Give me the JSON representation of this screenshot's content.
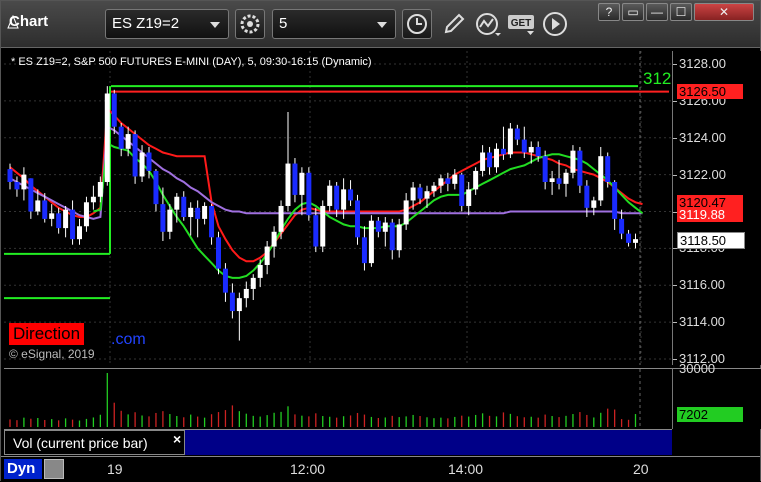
{
  "window": {
    "title": "Chart",
    "symbol": "ES Z19=2",
    "interval": "5",
    "controls": {
      "help": "?",
      "restore": "▭",
      "minimize": "—",
      "maximize": "☐",
      "close": "✕"
    }
  },
  "toolbar": {
    "icons": [
      "settings-icon",
      "clock-icon",
      "pencil-icon",
      "study-icon",
      "get-icon",
      "play-icon"
    ],
    "get_label": "GET"
  },
  "chart": {
    "info_line": "* ES Z19=2, S&P 500 FUTURES E-MINI (DAY), 5, 09:30-16:15 (Dynamic)",
    "direction_label": "Direction",
    "direction_tail": ".com",
    "copyright": "© eSignal, 2019",
    "line_label": "312",
    "price_labels": {
      "red_line": "3126.50",
      "ma_red": "3120.47",
      "ma_purple": "3119.88",
      "last_price": "3118.50"
    },
    "volume_label": "7202",
    "volume_axis_top": "30000",
    "legend_text": "Vol (current price bar)",
    "legend_close": "×",
    "dyn_label": "Dyn",
    "time_labels": [
      "19",
      "12:00",
      "14:00",
      "20"
    ]
  },
  "colors": {
    "up": "#ffffff",
    "down": "#1a2bff",
    "ma_red": "#ff1a1a",
    "ma_green": "#22dd22",
    "ma_purple": "#a070e0",
    "level_green": "#22ee22",
    "level_red": "#ff2020",
    "vol_up": "#22cc22",
    "vol_down": "#cc2222"
  },
  "chart_data": {
    "type": "candlestick",
    "y_axis_ticks": [
      "3128.00",
      "3126.00",
      "3124.00",
      "3122.00",
      "3120.00",
      "3118.00",
      "3116.00",
      "3114.00",
      "3112.00"
    ],
    "ylim": [
      3111.5,
      3128.5
    ],
    "x_ticks": [
      "19",
      "12:00",
      "14:00",
      "20"
    ],
    "levels": {
      "green_upper": 3126.8,
      "red_upper": 3126.5,
      "green_lower_left": 3115.3,
      "green_mid_left": 3117.7
    },
    "candles": [
      [
        3122.3,
        3122.6,
        3121.2,
        3121.6
      ],
      [
        3121.6,
        3121.9,
        3120.8,
        3121.2
      ],
      [
        3121.2,
        3122.4,
        3120.6,
        3122.0
      ],
      [
        3121.8,
        3121.8,
        3119.6,
        3120.0
      ],
      [
        3120.0,
        3121.2,
        3119.8,
        3120.6
      ],
      [
        3120.6,
        3121.0,
        3119.4,
        3119.6
      ],
      [
        3119.6,
        3120.4,
        3119.2,
        3119.9
      ],
      [
        3119.9,
        3120.2,
        3118.8,
        3119.1
      ],
      [
        3119.1,
        3120.3,
        3118.6,
        3120.1
      ],
      [
        3120.1,
        3120.6,
        3118.2,
        3118.5
      ],
      [
        3118.5,
        3119.6,
        3118.2,
        3119.2
      ],
      [
        3119.2,
        3120.8,
        3118.9,
        3120.5
      ],
      [
        3120.5,
        3121.4,
        3120.1,
        3120.8
      ],
      [
        3120.8,
        3121.9,
        3120.5,
        3121.6
      ],
      [
        3121.6,
        3126.8,
        3121.4,
        3126.4
      ],
      [
        3126.4,
        3126.6,
        3124.2,
        3124.6
      ],
      [
        3124.6,
        3124.8,
        3123.0,
        3123.4
      ],
      [
        3123.4,
        3124.6,
        3123.0,
        3124.2
      ],
      [
        3124.2,
        3124.4,
        3121.5,
        3121.9
      ],
      [
        3121.9,
        3123.6,
        3121.6,
        3123.2
      ],
      [
        3123.2,
        3123.5,
        3121.8,
        3122.2
      ],
      [
        3122.2,
        3122.3,
        3120.0,
        3120.4
      ],
      [
        3120.4,
        3121.3,
        3118.4,
        3118.9
      ],
      [
        3118.9,
        3120.4,
        3118.5,
        3120.1
      ],
      [
        3120.1,
        3121.0,
        3119.4,
        3120.8
      ],
      [
        3120.8,
        3121.1,
        3119.5,
        3119.7
      ],
      [
        3119.7,
        3120.5,
        3118.7,
        3120.2
      ],
      [
        3120.2,
        3120.6,
        3118.6,
        3119.6
      ],
      [
        3119.6,
        3120.5,
        3119.3,
        3120.3
      ],
      [
        3120.3,
        3120.4,
        3118.2,
        3118.6
      ],
      [
        3118.6,
        3118.9,
        3116.6,
        3116.9
      ],
      [
        3116.9,
        3117.2,
        3115.1,
        3115.6
      ],
      [
        3115.6,
        3116.1,
        3114.2,
        3114.6
      ],
      [
        3114.6,
        3115.6,
        3113.0,
        3115.3
      ],
      [
        3115.3,
        3116.2,
        3114.8,
        3115.8
      ],
      [
        3115.8,
        3116.6,
        3115.2,
        3116.4
      ],
      [
        3116.4,
        3117.4,
        3115.9,
        3117.1
      ],
      [
        3117.1,
        3118.4,
        3116.6,
        3118.1
      ],
      [
        3118.1,
        3119.2,
        3117.5,
        3118.9
      ],
      [
        3118.9,
        3120.6,
        3118.5,
        3120.3
      ],
      [
        3120.3,
        3125.4,
        3120.0,
        3122.6
      ],
      [
        3122.6,
        3122.9,
        3120.5,
        3120.9
      ],
      [
        3120.9,
        3122.4,
        3119.8,
        3122.1
      ],
      [
        3122.1,
        3122.4,
        3119.5,
        3119.8
      ],
      [
        3119.8,
        3120.2,
        3117.8,
        3118.1
      ],
      [
        3118.1,
        3120.6,
        3117.8,
        3120.3
      ],
      [
        3120.3,
        3121.7,
        3120.0,
        3121.4
      ],
      [
        3121.4,
        3121.6,
        3119.7,
        3120.1
      ],
      [
        3120.1,
        3121.8,
        3119.6,
        3121.2
      ],
      [
        3121.2,
        3121.7,
        3120.3,
        3120.6
      ],
      [
        3120.6,
        3120.9,
        3118.2,
        3118.6
      ],
      [
        3118.6,
        3119.2,
        3116.8,
        3117.2
      ],
      [
        3117.2,
        3119.8,
        3117.0,
        3119.5
      ],
      [
        3119.5,
        3119.7,
        3118.6,
        3118.9
      ],
      [
        3118.9,
        3119.7,
        3118.1,
        3119.4
      ],
      [
        3119.4,
        3119.6,
        3117.4,
        3117.9
      ],
      [
        3117.9,
        3119.6,
        3117.5,
        3119.3
      ],
      [
        3119.3,
        3121.0,
        3119.0,
        3120.6
      ],
      [
        3120.6,
        3121.6,
        3120.1,
        3121.3
      ],
      [
        3121.3,
        3121.5,
        3120.4,
        3120.7
      ],
      [
        3120.7,
        3121.4,
        3120.2,
        3121.1
      ],
      [
        3121.1,
        3121.6,
        3120.8,
        3121.4
      ],
      [
        3121.4,
        3122.0,
        3121.0,
        3121.8
      ],
      [
        3121.8,
        3122.1,
        3121.1,
        3121.5
      ],
      [
        3121.5,
        3122.3,
        3121.2,
        3122.0
      ],
      [
        3122.0,
        3122.1,
        3120.0,
        3120.3
      ],
      [
        3120.3,
        3121.6,
        3119.8,
        3121.2
      ],
      [
        3121.2,
        3122.4,
        3120.9,
        3122.2
      ],
      [
        3122.2,
        3123.6,
        3121.9,
        3123.2
      ],
      [
        3123.2,
        3123.5,
        3122.0,
        3122.4
      ],
      [
        3122.4,
        3123.7,
        3122.1,
        3123.4
      ],
      [
        3123.4,
        3124.6,
        3122.8,
        3123.1
      ],
      [
        3123.1,
        3124.8,
        3122.9,
        3124.5
      ],
      [
        3124.5,
        3124.7,
        3123.6,
        3123.9
      ],
      [
        3123.9,
        3124.6,
        3122.9,
        3123.2
      ],
      [
        3123.2,
        3123.8,
        3122.6,
        3123.5
      ],
      [
        3123.5,
        3123.8,
        3122.7,
        3123.0
      ],
      [
        3123.0,
        3123.3,
        3121.2,
        3121.6
      ],
      [
        3121.6,
        3122.2,
        3120.9,
        3121.8
      ],
      [
        3121.8,
        3122.8,
        3121.2,
        3121.5
      ],
      [
        3121.5,
        3122.3,
        3120.8,
        3122.1
      ],
      [
        3122.1,
        3123.6,
        3121.8,
        3123.3
      ],
      [
        3123.3,
        3123.5,
        3121.0,
        3121.4
      ],
      [
        3121.4,
        3121.7,
        3119.7,
        3120.2
      ],
      [
        3120.2,
        3120.8,
        3119.8,
        3120.6
      ],
      [
        3120.6,
        3123.5,
        3120.3,
        3123.0
      ],
      [
        3123.0,
        3123.2,
        3121.3,
        3121.6
      ],
      [
        3121.6,
        3121.7,
        3119.0,
        3119.6
      ],
      [
        3119.6,
        3120.1,
        3118.5,
        3118.8
      ],
      [
        3118.8,
        3119.0,
        3118.1,
        3118.3
      ],
      [
        3118.3,
        3118.8,
        3118.0,
        3118.5
      ]
    ],
    "series": [
      {
        "name": "",
        "color": "ma_red",
        "values": [
          3122.4,
          3122.1,
          3121.8,
          3121.4,
          3121.1,
          3120.8,
          3120.5,
          3120.2,
          3120.0,
          3119.8,
          3119.7,
          3119.7,
          3119.9,
          3120.2,
          3125.6,
          3125.2,
          3124.8,
          3124.5,
          3124.2,
          3123.9,
          3123.6,
          3123.4,
          3123.2,
          3123.1,
          3123.0,
          3123.0,
          3123.0,
          3123.0,
          3123.0,
          3120.5,
          3119.2,
          3118.5,
          3117.9,
          3117.5,
          3117.3,
          3117.3,
          3117.5,
          3117.8,
          3118.3,
          3118.8,
          3119.3,
          3119.8,
          3120.1,
          3120.2,
          3120.1,
          3120.0,
          3120.0,
          3120.0,
          3120.0,
          3120.0,
          3120.0,
          3120.0,
          3120.0,
          3120.0,
          3120.0,
          3120.0,
          3120.0,
          3120.1,
          3120.3,
          3120.5,
          3120.8,
          3121.1,
          3121.4,
          3121.7,
          3122.0,
          3122.2,
          3122.4,
          3122.6,
          3122.8,
          3122.9,
          3123.0,
          3123.1,
          3123.2,
          3123.2,
          3123.2,
          3123.1,
          3123.0,
          3122.9,
          3122.8,
          3122.6,
          3122.5,
          3122.3,
          3122.2,
          3122.1,
          3122.0,
          3121.8,
          3121.6,
          3121.3,
          3121.0,
          3120.7,
          3120.5,
          3120.4
        ]
      },
      {
        "name": "",
        "color": "ma_purple",
        "values": [
          3121.8,
          3121.6,
          3121.4,
          3121.2,
          3121.0,
          3120.8,
          3120.6,
          3120.4,
          3120.2,
          3120.0,
          3119.8,
          3119.7,
          3119.6,
          3119.7,
          3124.6,
          3124.4,
          3124.1,
          3123.8,
          3123.5,
          3123.2,
          3122.9,
          3122.6,
          3122.3,
          3122.1,
          3121.8,
          3121.6,
          3121.3,
          3121.1,
          3120.8,
          3120.5,
          3120.3,
          3120.1,
          3120.0,
          3120.0,
          3119.9,
          3119.9,
          3119.9,
          3119.9,
          3119.9,
          3119.9,
          3119.9,
          3119.9,
          3119.9,
          3119.9,
          3119.9,
          3119.9,
          3119.9,
          3119.9,
          3119.9,
          3119.9,
          3119.9,
          3119.9,
          3119.9,
          3119.9,
          3119.9,
          3119.9,
          3119.9,
          3119.9,
          3119.9,
          3119.9,
          3119.9,
          3119.9,
          3119.9,
          3119.9,
          3119.9,
          3119.9,
          3119.9,
          3119.9,
          3119.9,
          3119.9,
          3119.9,
          3119.9,
          3120.0,
          3120.0,
          3120.0,
          3120.0,
          3120.0,
          3120.0,
          3120.0,
          3120.0,
          3120.0,
          3120.0,
          3120.0,
          3120.0,
          3120.0,
          3120.0,
          3120.0,
          3120.0,
          3119.9,
          3119.9,
          3119.9,
          3119.9
        ]
      },
      {
        "name": "",
        "color": "ma_green",
        "values": [
          null,
          null,
          null,
          null,
          null,
          null,
          null,
          null,
          null,
          null,
          null,
          null,
          3120.0,
          3120.1,
          3123.7,
          3123.5,
          3123.4,
          3123.3,
          3122.9,
          3122.6,
          3122.2,
          3121.6,
          3120.9,
          3120.3,
          3119.7,
          3119.2,
          3118.6,
          3118.0,
          3117.6,
          3117.2,
          3116.8,
          3116.5,
          3116.4,
          3116.4,
          3116.5,
          3116.8,
          3117.2,
          3117.7,
          3118.3,
          3119.0,
          3119.6,
          3120.1,
          3120.4,
          3120.5,
          3120.3,
          3120.0,
          3119.7,
          3119.5,
          3119.3,
          3119.2,
          3119.2,
          3119.1,
          3119.1,
          3119.1,
          3119.2,
          3119.2,
          3119.2,
          3119.4,
          3119.7,
          3120.0,
          3120.3,
          3120.6,
          3120.8,
          3120.9,
          3120.9,
          3120.9,
          3121.1,
          3121.3,
          3121.5,
          3121.7,
          3121.9,
          3122.1,
          3122.3,
          3122.4,
          3122.5,
          3122.7,
          3122.9,
          3123.0,
          3123.1,
          3123.1,
          3123.0,
          3122.9,
          3122.8,
          3122.6,
          3122.3,
          3122.0,
          3121.7,
          3121.3,
          3120.9,
          3120.5,
          3120.2,
          3119.9
        ]
      }
    ],
    "volume": {
      "ymax": 30000,
      "last": 7202,
      "values": [
        4200,
        3800,
        5200,
        4600,
        5000,
        3900,
        4400,
        3700,
        4800,
        4100,
        3600,
        4500,
        5300,
        6800,
        30000,
        13500,
        9000,
        7000,
        8200,
        6400,
        5900,
        7800,
        8800,
        7200,
        6100,
        5400,
        6900,
        5800,
        5200,
        7100,
        8300,
        9400,
        12000,
        8800,
        7400,
        6200,
        5800,
        6600,
        7900,
        8400,
        11500,
        7000,
        6300,
        5900,
        7600,
        6100,
        5700,
        5200,
        6000,
        6400,
        7800,
        6900,
        5600,
        5000,
        5300,
        6200,
        5500,
        5900,
        6700,
        6100,
        5400,
        4900,
        5200,
        4800,
        5600,
        6300,
        5800,
        6700,
        7600,
        6200,
        5900,
        8100,
        7300,
        6000,
        5400,
        5700,
        5200,
        6900,
        6100,
        5500,
        6200,
        7200,
        8300,
        6700,
        5300,
        7900,
        10200,
        9700,
        4400,
        4000,
        7202
      ],
      "up": [
        false,
        false,
        true,
        false,
        true,
        false,
        true,
        false,
        true,
        false,
        true,
        true,
        true,
        true,
        true,
        false,
        false,
        true,
        false,
        true,
        false,
        false,
        false,
        true,
        true,
        false,
        true,
        false,
        true,
        false,
        false,
        false,
        false,
        true,
        true,
        true,
        true,
        true,
        true,
        true,
        true,
        false,
        true,
        false,
        false,
        true,
        true,
        false,
        true,
        false,
        false,
        false,
        true,
        false,
        true,
        false,
        true,
        true,
        true,
        false,
        true,
        true,
        true,
        false,
        true,
        false,
        true,
        true,
        true,
        false,
        true,
        false,
        true,
        false,
        false,
        true,
        false,
        false,
        true,
        false,
        true,
        true,
        false,
        false,
        true,
        true,
        false,
        false,
        false,
        false,
        true
      ]
    }
  }
}
